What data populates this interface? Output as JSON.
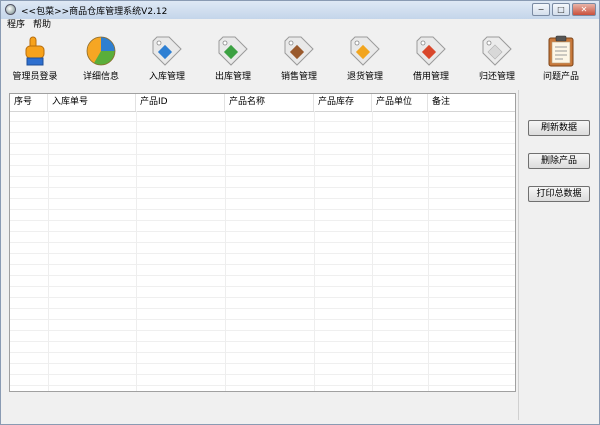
{
  "window": {
    "title": "<<包菜>>商品仓库管理系统V2.12",
    "controls": {
      "minimize": "−",
      "maximize": "□",
      "close": "✕"
    }
  },
  "menu": [
    "程序",
    "帮助"
  ],
  "toolbar": [
    {
      "label": "管理员登录",
      "icon": "pointing-hand-icon",
      "color": "#f7a21b"
    },
    {
      "label": "详细信息",
      "icon": "pie-chart-icon",
      "color": "#2f7fd0"
    },
    {
      "label": "入库管理",
      "icon": "tag-icon",
      "color": "#2d7fd3"
    },
    {
      "label": "出库管理",
      "icon": "tag-icon",
      "color": "#3ca142"
    },
    {
      "label": "销售管理",
      "icon": "tag-icon",
      "color": "#9a5a2d"
    },
    {
      "label": "退货管理",
      "icon": "tag-icon",
      "color": "#f2a51e"
    },
    {
      "label": "借用管理",
      "icon": "tag-icon",
      "color": "#d9472b"
    },
    {
      "label": "归还管理",
      "icon": "tag-icon",
      "color": "#d8d8d8"
    },
    {
      "label": "问题产品",
      "icon": "clipboard-icon",
      "color": "#c8783a"
    }
  ],
  "table": {
    "columns": [
      "序号",
      "入库单号",
      "产品ID",
      "产品名称",
      "产品库存",
      "产品单位",
      "备注"
    ],
    "rows": []
  },
  "actions": {
    "refresh": "刷新数据",
    "delete": "删除产品",
    "print": "打印总数据"
  }
}
